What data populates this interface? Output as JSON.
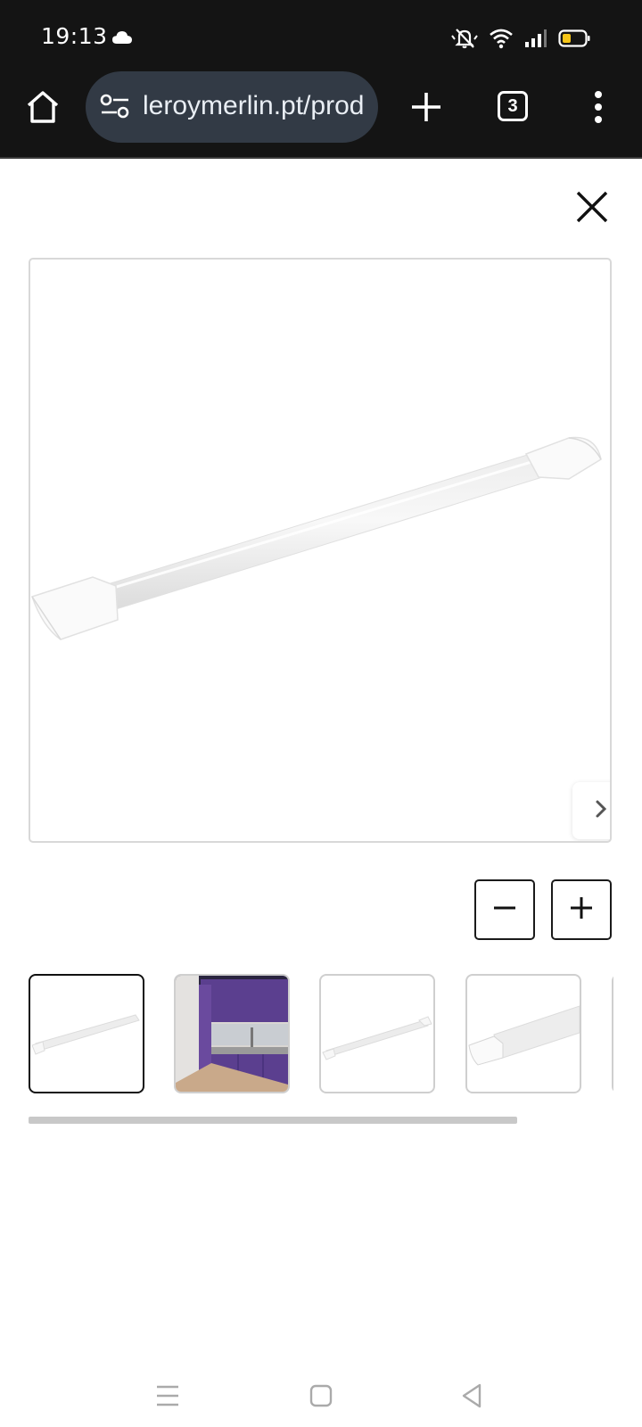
{
  "status_bar": {
    "time": "19:13",
    "icons": [
      "cloud-icon",
      "mute-icon",
      "wifi-icon",
      "signal-icon",
      "battery-icon"
    ],
    "battery_color": "#f5c518"
  },
  "browser": {
    "url": "leroymerlin.pt/produtos",
    "tab_count": "3",
    "icons": [
      "home-icon",
      "site-settings-icon",
      "plus-icon",
      "menu-dots-icon"
    ]
  },
  "viewer": {
    "icons": [
      "close-icon",
      "chevron-right-icon",
      "zoom-out-icon",
      "zoom-in-icon"
    ],
    "selected_thumbnail": 1,
    "thumbnail_count_visible": 5,
    "kitchen_accent": "#5b3f8f"
  },
  "system_nav": {
    "icons": [
      "recents-icon",
      "home-square-icon",
      "back-icon"
    ]
  }
}
